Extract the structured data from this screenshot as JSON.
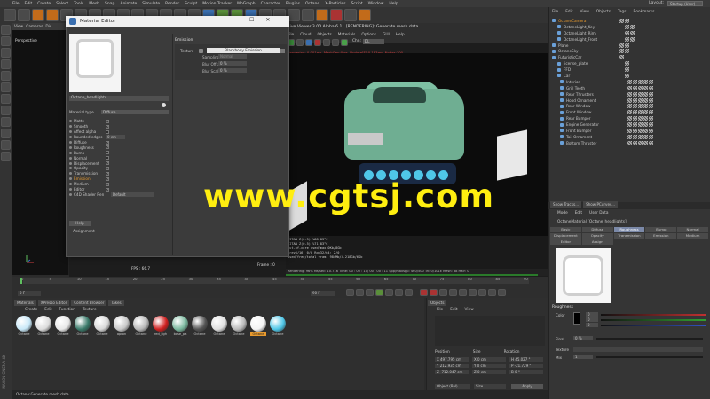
{
  "menubar": {
    "items": [
      "File",
      "Edit",
      "Create",
      "Select",
      "Tools",
      "Mesh",
      "Snap",
      "Animate",
      "Simulate",
      "Render",
      "Sculpt",
      "Motion Tracker",
      "MoGraph",
      "Character",
      "Plugins",
      "Octane",
      "X-Particles",
      "Script",
      "Window",
      "Help"
    ],
    "layout_label": "Layout:",
    "layout_value": "Startup (User)"
  },
  "viewport": {
    "tabs": [
      "View",
      "Cameras",
      "Dis"
    ],
    "label": "Perspective",
    "fps": "FPS : 66.7",
    "frame": "Frame : 0"
  },
  "render_viewer": {
    "title": "Live Viewer 3.00 Alpha 6.1",
    "status_title": "[RENDERING]: Generate mesh data...",
    "menu": [
      "File",
      "Cloud",
      "Objects",
      "Materials",
      "Options",
      "GUI",
      "Help"
    ],
    "channel_label": "Chn:",
    "channel_value": "DL",
    "status_line": "Rendering: 0.001ms, MeshGen:0ms, Update[E]:0.183ms, Nodes:100",
    "stats": [
      "TITAN Z(0.5)           %88     83°C",
      "TITAN Z(0.5)           %71     83°C",
      "Out-of-core used/max:0Kb/8Gb",
      "Grey8/16: 0/0          Rgb32/64: 2/0",
      "Used/free/total vram: 984Mb/4.218Gb/6Gb"
    ],
    "bottom": "Rendering: 96%  Ms/sec: 10.716   Time: 00 : 00 : 10/ 00 : 00 : 11   Spp/maxspp: 460/500   Tri: 0/101k   Mesh: 38   Hair: 0",
    "progress": 0.96
  },
  "material_editor": {
    "title": "Material Editor",
    "win_buttons": [
      "—",
      "☐",
      "✕"
    ],
    "material_name": "Octane_headlights",
    "material_type_label": "Material type",
    "material_type_value": "Diffuse",
    "channels": [
      {
        "label": "Matte",
        "checked": true
      },
      {
        "label": "Smooth",
        "checked": true
      },
      {
        "label": "Affect alpha",
        "checked": false
      },
      {
        "label": "Rounded edges",
        "value": "0 cm"
      },
      {
        "label": "Diffuse",
        "checked": true
      },
      {
        "label": "Roughness",
        "checked": true
      },
      {
        "label": "Bump",
        "checked": false
      },
      {
        "label": "Normal",
        "checked": false
      },
      {
        "label": "Displacement",
        "checked": true
      },
      {
        "label": "Opacity",
        "checked": true
      },
      {
        "label": "Transmission",
        "checked": true
      },
      {
        "label": "Emission",
        "checked": true,
        "highlight": true
      },
      {
        "label": "Medium",
        "checked": true
      },
      {
        "label": "Editor",
        "checked": true
      },
      {
        "label": "C4D Shader Render Size",
        "value": "Default"
      }
    ],
    "help_label": "Help",
    "assignment_label": "Assignment",
    "emission": {
      "header": "Emission",
      "texture_label": "Texture",
      "texture_value": "Blackbody Emission",
      "props": [
        {
          "label": "Sampling",
          "value": "Normal"
        },
        {
          "label": "Blur Offset",
          "value": "0 %"
        },
        {
          "label": "Blur Scale",
          "value": "0 %"
        }
      ]
    }
  },
  "object_manager": {
    "menu": [
      "File",
      "Edit",
      "View",
      "Objects",
      "Tags",
      "Bookmarks"
    ],
    "items": [
      {
        "name": "OctaneCamera",
        "highlight": true,
        "selected": false
      },
      {
        "name": "OctaneLight_Key",
        "highlight": false,
        "selected": false
      },
      {
        "name": "OctaneLight_Rim",
        "highlight": false,
        "selected": false
      },
      {
        "name": "OctaneLight_Front",
        "highlight": false,
        "selected": false
      },
      {
        "name": "Plane",
        "highlight": false,
        "selected": false
      },
      {
        "name": "OctaneSky",
        "highlight": false,
        "selected": false
      },
      {
        "name": "FuturisticCar",
        "highlight": false,
        "selected": false
      },
      {
        "name": "license_plate",
        "highlight": false,
        "selected": false
      },
      {
        "name": "FFD",
        "highlight": false,
        "selected": false
      },
      {
        "name": "Car",
        "highlight": false,
        "selected": false
      },
      {
        "name": "Interior",
        "highlight": false,
        "selected": false
      },
      {
        "name": "Grill Teeth",
        "highlight": false,
        "selected": false
      },
      {
        "name": "Rear Thrusters",
        "highlight": false,
        "selected": false
      },
      {
        "name": "Hood Ornament",
        "highlight": false,
        "selected": false
      },
      {
        "name": "Rear Window",
        "highlight": false,
        "selected": false
      },
      {
        "name": "Front Window",
        "highlight": false,
        "selected": false
      },
      {
        "name": "Rear Bumper",
        "highlight": false,
        "selected": false
      },
      {
        "name": "Engine Generator",
        "highlight": false,
        "selected": false
      },
      {
        "name": "Front Bumper",
        "highlight": false,
        "selected": false
      },
      {
        "name": "Tail Ornament",
        "highlight": false,
        "selected": false
      },
      {
        "name": "Bottom Thruster",
        "highlight": false,
        "selected": false
      }
    ],
    "tabs": [
      "Show Tracks...",
      "Show PCurves..."
    ]
  },
  "attribute_manager": {
    "menu": [
      "Mode",
      "Edit",
      "User Data"
    ],
    "object": "OctaneMaterial [Octane_headlights]",
    "tabs": [
      {
        "label": "Basic",
        "active": false
      },
      {
        "label": "Diffuse",
        "active": false
      },
      {
        "label": "Roughness",
        "active": true
      },
      {
        "label": "Bump",
        "active": false
      },
      {
        "label": "Normal",
        "active": false
      },
      {
        "label": "Displacement",
        "active": false
      },
      {
        "label": "Opacity",
        "active": false
      },
      {
        "label": "Transmission",
        "active": false
      },
      {
        "label": "Emission",
        "active": false
      },
      {
        "label": "Medium",
        "active": false
      },
      {
        "label": "Editor",
        "active": false
      },
      {
        "label": "Assign",
        "active": false
      }
    ],
    "section": "Roughness",
    "color_label": "Color",
    "color_channels": [
      {
        "value": "0",
        "color": "#c03030"
      },
      {
        "value": "0",
        "color": "#30a030"
      },
      {
        "value": "0",
        "color": "#3050c0"
      }
    ],
    "float_label": "Float",
    "float_value": "0 %",
    "texture_label": "Texture",
    "mix_label": "Mix",
    "mix_value": "1"
  },
  "timeline": {
    "ticks": [
      "0",
      "5",
      "10",
      "15",
      "20",
      "25",
      "30",
      "35",
      "40",
      "45",
      "50",
      "55",
      "60",
      "65",
      "70",
      "75",
      "80",
      "85",
      "90"
    ],
    "start_frame": "0 F",
    "end_frame": "90 F"
  },
  "materials": {
    "tabs": [
      "Materials",
      "XPresso Editor",
      "Content Browser",
      "Takes"
    ],
    "menu": [
      "Create",
      "Edit",
      "Function",
      "Texture"
    ],
    "balls": [
      {
        "name": "Octane",
        "color": "#c8e8f8",
        "selected": false
      },
      {
        "name": "Octane",
        "color": "#dcdcdc",
        "selected": false
      },
      {
        "name": "Octane",
        "color": "#e8e8e8",
        "selected": false
      },
      {
        "name": "Octane",
        "color": "#3a7a6a",
        "selected": false
      },
      {
        "name": "Octane",
        "color": "#d8d8d8",
        "selected": false
      },
      {
        "name": "apron",
        "color": "#c8c8c8",
        "selected": false
      },
      {
        "name": "Octane",
        "color": "#b8b8b8",
        "selected": false
      },
      {
        "name": "red_ligh",
        "color": "#d02020",
        "selected": false
      },
      {
        "name": "base_pa",
        "color": "#7ab89e",
        "selected": false
      },
      {
        "name": "Octane",
        "color": "#555555",
        "selected": false
      },
      {
        "name": "Octane",
        "color": "#e0e0e0",
        "selected": false
      },
      {
        "name": "Octane",
        "color": "#bbbbbb",
        "selected": false
      },
      {
        "name": "Octane",
        "color": "#f4f4f4",
        "selected": true
      },
      {
        "name": "Octane",
        "color": "#4fc7e8",
        "selected": false
      }
    ]
  },
  "coordinates": {
    "tab": "Objects",
    "menu": [
      "File",
      "Edit",
      "View"
    ],
    "headers": [
      "Position",
      "Size",
      "Rotation"
    ],
    "fields": [
      [
        "X  497.795 cm",
        "X  0 cm",
        "H  45.027 °"
      ],
      [
        "Y  212.935 cm",
        "Y  0 cm",
        "P  -21.729 °"
      ],
      [
        "Z  -712.047 cm",
        "Z  0 cm",
        "B  0 °"
      ]
    ],
    "mode": "Object (Rel)",
    "size_mode": "Size",
    "apply": "Apply"
  },
  "status_bar": "Octane:Generate mesh data...",
  "branding": "MAXON CINEMA 4D",
  "watermark": "www.cgtsj.com"
}
